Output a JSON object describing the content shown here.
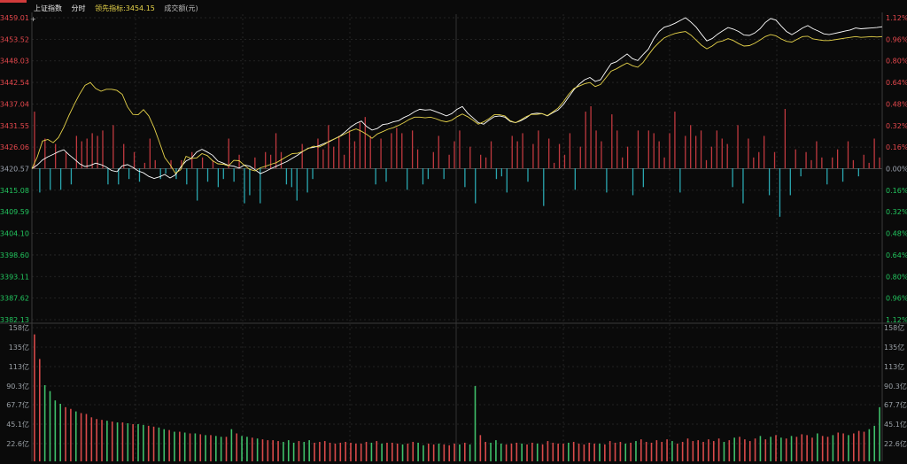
{
  "header": {
    "index_name": "上证指数",
    "period": "分时",
    "leading_label": "领先指标:3454.15",
    "turnover_label": "成交额(元)"
  },
  "colors": {
    "up": "#e5484d",
    "down": "#22c55e",
    "flat": "#9ca3af",
    "price_line": "#ffffff",
    "leading_line": "#e6d34a",
    "bar_up": "#c0393f",
    "bar_down": "#2aa7b0",
    "grid": "#3a3a3a",
    "grid_dotted": "#2b2b2b"
  },
  "chart_data": [
    {
      "type": "line",
      "subtype": "intraday",
      "y_left_ticks": [
        "3459.01",
        "3453.52",
        "3448.03",
        "3442.54",
        "3437.04",
        "3431.55",
        "3426.06",
        "3420.57",
        "3415.08",
        "3409.59",
        "3404.10",
        "3398.60",
        "3393.11",
        "3387.62",
        "3382.13"
      ],
      "y_right_ticks": [
        "1.12%",
        "0.96%",
        "0.80%",
        "0.64%",
        "0.48%",
        "0.32%",
        "0.16%",
        "0.00%",
        "0.16%",
        "0.32%",
        "0.48%",
        "0.64%",
        "0.80%",
        "0.96%",
        "1.12%"
      ],
      "ylim": [
        3382.13,
        3459.01
      ],
      "base_price": 3420.57,
      "series": [
        {
          "name": "上证指数",
          "values": [
            3420.6,
            3421.5,
            3422.8,
            3423.6,
            3424.2,
            3424.9,
            3425.4,
            3424.1,
            3423.0,
            3421.8,
            3421.1,
            3421.4,
            3422.0,
            3421.6,
            3421.0,
            3420.1,
            3419.8,
            3421.3,
            3421.6,
            3420.9,
            3420.0,
            3419.5,
            3418.6,
            3418.1,
            3418.5,
            3419.1,
            3418.2,
            3419.0,
            3421.0,
            3422.5,
            3423.2,
            3424.8,
            3425.5,
            3424.8,
            3424.0,
            3422.5,
            3422.0,
            3421.4,
            3421.2,
            3420.7,
            3421.5,
            3421.2,
            3420.3,
            3419.3,
            3419.9,
            3420.6,
            3421.2,
            3421.8,
            3422.4,
            3423.2,
            3424.0,
            3425.0,
            3425.8,
            3426.0,
            3426.4,
            3427.0,
            3427.5,
            3428.2,
            3428.9,
            3430.0,
            3431.2,
            3432.1,
            3432.7,
            3431.3,
            3430.4,
            3430.8,
            3431.8,
            3432.0,
            3432.5,
            3432.8,
            3433.6,
            3434.2,
            3435.1,
            3435.7,
            3435.5,
            3435.6,
            3435.1,
            3434.6,
            3434.0,
            3434.6,
            3435.7,
            3436.4,
            3434.7,
            3433.5,
            3432.3,
            3431.9,
            3432.9,
            3433.8,
            3434.0,
            3433.7,
            3432.6,
            3432.3,
            3432.8,
            3433.5,
            3434.5,
            3434.7,
            3434.6,
            3434.0,
            3434.8,
            3435.5,
            3436.9,
            3438.8,
            3440.7,
            3442.1,
            3443.2,
            3443.8,
            3442.8,
            3443.2,
            3445.3,
            3447.3,
            3447.8,
            3448.8,
            3449.8,
            3448.6,
            3448.1,
            3449.6,
            3451.0,
            3453.6,
            3455.5,
            3456.6,
            3457.0,
            3457.6,
            3458.3,
            3459.0,
            3457.9,
            3456.6,
            3454.8,
            3453.1,
            3453.7,
            3454.8,
            3455.7,
            3456.5,
            3456.1,
            3455.5,
            3454.6,
            3454.5,
            3455.1,
            3456.2,
            3457.8,
            3458.8,
            3458.4,
            3456.9,
            3455.5,
            3454.7,
            3455.5,
            3456.4,
            3457.0,
            3456.2,
            3455.6,
            3454.9,
            3454.7,
            3455.0,
            3455.3,
            3455.6,
            3455.9,
            3456.4,
            3456.2,
            3456.3,
            3456.4,
            3456.5,
            3456.7
          ]
        },
        {
          "name": "领先指标",
          "values": [
            3420.6,
            3423.5,
            3427.6,
            3428.0,
            3427.2,
            3428.5,
            3431.1,
            3434.2,
            3437.0,
            3439.6,
            3441.8,
            3442.5,
            3441.0,
            3440.3,
            3440.8,
            3440.8,
            3440.5,
            3439.5,
            3436.3,
            3434.4,
            3434.3,
            3435.6,
            3434.0,
            3431.0,
            3427.3,
            3423.4,
            3421.6,
            3419.4,
            3420.3,
            3423.7,
            3423.2,
            3423.3,
            3424.4,
            3423.9,
            3422.6,
            3421.8,
            3421.7,
            3421.3,
            3422.7,
            3422.6,
            3421.4,
            3420.4,
            3420.0,
            3420.8,
            3421.2,
            3421.7,
            3422.1,
            3422.9,
            3423.7,
            3424.4,
            3424.5,
            3425.0,
            3425.7,
            3426.3,
            3426.1,
            3426.7,
            3427.6,
            3428.2,
            3428.8,
            3429.5,
            3430.2,
            3430.7,
            3430.1,
            3429.3,
            3428.3,
            3429.4,
            3430.0,
            3430.6,
            3431.0,
            3431.6,
            3432.3,
            3433.1,
            3433.7,
            3433.7,
            3433.5,
            3433.7,
            3433.3,
            3432.8,
            3432.5,
            3432.9,
            3433.8,
            3434.5,
            3433.8,
            3432.9,
            3431.9,
            3432.5,
            3433.3,
            3434.3,
            3434.3,
            3434.0,
            3432.8,
            3432.3,
            3433.0,
            3433.8,
            3434.4,
            3434.4,
            3434.6,
            3434.1,
            3435.0,
            3436.0,
            3437.6,
            3439.5,
            3441.0,
            3441.6,
            3442.2,
            3442.5,
            3441.5,
            3442.0,
            3443.7,
            3445.4,
            3446.0,
            3446.8,
            3447.5,
            3446.8,
            3446.4,
            3447.6,
            3449.5,
            3451.3,
            3452.7,
            3453.9,
            3454.5,
            3455.0,
            3455.3,
            3455.5,
            3454.6,
            3453.3,
            3452.0,
            3451.1,
            3451.8,
            3452.8,
            3453.1,
            3453.7,
            3453.2,
            3452.4,
            3451.8,
            3451.9,
            3452.5,
            3453.3,
            3454.2,
            3454.7,
            3454.4,
            3453.6,
            3453.0,
            3452.8,
            3453.5,
            3454.2,
            3454.3,
            3453.6,
            3453.4,
            3453.2,
            3453.2,
            3453.4,
            3453.6,
            3453.8,
            3454.0,
            3454.2,
            3454.0,
            3454.1,
            3454.2,
            3454.1,
            3454.2
          ]
        }
      ]
    },
    {
      "type": "bar",
      "subtype": "intraday_flow",
      "note_units": "percent_of_base",
      "values": [
        0.21,
        -0.09,
        0.11,
        -0.08,
        0.09,
        -0.08,
        0.06,
        -0.06,
        0.12,
        0.1,
        0.11,
        0.13,
        0.12,
        0.14,
        -0.06,
        0.16,
        -0.06,
        0.09,
        -0.04,
        0.06,
        -0.05,
        0.02,
        0.11,
        0.03,
        -0.04,
        -0.02,
        0.03,
        -0.04,
        0.03,
        -0.06,
        0.06,
        -0.12,
        0.04,
        -0.05,
        0.03,
        -0.07,
        -0.04,
        0.11,
        -0.05,
        0.05,
        -0.13,
        -0.1,
        0.04,
        -0.13,
        0.06,
        0.05,
        0.13,
        0.06,
        -0.06,
        -0.07,
        -0.12,
        0.09,
        -0.09,
        -0.04,
        0.11,
        0.07,
        0.16,
        0.08,
        0.12,
        0.05,
        0.14,
        0.1,
        0.17,
        0.19,
        0.12,
        -0.06,
        0.11,
        -0.05,
        0.13,
        0.15,
        0.13,
        -0.08,
        0.14,
        0.07,
        -0.06,
        -0.04,
        0.06,
        0.12,
        -0.04,
        0.05,
        0.1,
        0.14,
        -0.07,
        0.08,
        -0.13,
        0.05,
        0.04,
        0.1,
        -0.04,
        -0.03,
        -0.09,
        0.12,
        0.1,
        0.13,
        -0.05,
        0.09,
        0.14,
        -0.14,
        0.11,
        0.02,
        0.09,
        0.05,
        0.13,
        -0.08,
        0.08,
        0.21,
        0.23,
        0.14,
        0.1,
        -0.09,
        0.2,
        0.14,
        0.04,
        0.08,
        -0.1,
        0.14,
        -0.07,
        0.14,
        0.13,
        0.1,
        0.04,
        0.13,
        0.21,
        -0.09,
        0.12,
        0.16,
        0.12,
        0.14,
        0.03,
        0.08,
        0.14,
        0.11,
        0.09,
        -0.07,
        0.16,
        -0.13,
        0.11,
        0.04,
        0.06,
        0.12,
        -0.1,
        0.06,
        -0.18,
        0.22,
        -0.1,
        0.07,
        -0.03,
        0.06,
        0.03,
        0.1,
        0.04,
        -0.06,
        0.04,
        0.07,
        -0.05,
        0.1,
        0.03,
        -0.03,
        0.05,
        0.02,
        0.11,
        0.04
      ]
    },
    {
      "type": "bar",
      "subtype": "volume",
      "ylabel": "成交额(元)",
      "y_ticks": [
        "158亿",
        "135亿",
        "113亿",
        "90.3亿",
        "67.7亿",
        "45.1亿",
        "22.6亿"
      ],
      "ylim": [
        0,
        158
      ],
      "values": [
        150,
        121,
        90,
        83,
        72,
        68,
        64,
        62,
        59,
        57,
        56,
        52,
        50,
        49,
        48,
        47,
        46,
        46,
        45,
        44,
        44,
        43,
        42,
        41,
        40,
        38,
        37,
        35,
        35,
        34,
        33,
        33,
        32,
        31,
        31,
        30,
        29,
        29,
        38,
        33,
        30,
        29,
        28,
        27,
        26,
        25,
        25,
        24,
        23,
        25,
        22,
        24,
        23,
        25,
        22,
        23,
        24,
        22,
        21,
        22,
        23,
        22,
        21,
        21,
        23,
        22,
        24,
        21,
        22,
        22,
        21,
        20,
        21,
        23,
        22,
        19,
        21,
        20,
        21,
        20,
        19,
        21,
        20,
        22,
        20,
        89,
        31,
        23,
        22,
        25,
        21,
        20,
        21,
        22,
        21,
        20,
        22,
        21,
        20,
        24,
        22,
        21,
        21,
        22,
        23,
        21,
        20,
        22,
        21,
        21,
        20,
        24,
        22,
        23,
        21,
        22,
        24,
        26,
        23,
        22,
        25,
        23,
        26,
        24,
        21,
        23,
        27,
        24,
        25,
        23,
        26,
        24,
        27,
        23,
        25,
        28,
        29,
        26,
        24,
        27,
        30,
        26,
        29,
        31,
        28,
        27,
        30,
        29,
        32,
        31,
        28,
        33,
        30,
        29,
        31,
        34,
        33,
        31,
        33,
        36,
        35,
        38,
        42,
        64
      ],
      "up_flags": [
        1,
        1,
        0,
        0,
        0,
        0,
        1,
        1,
        0,
        1,
        1,
        1,
        1,
        1,
        0,
        1,
        0,
        1,
        0,
        1,
        0,
        0,
        1,
        1,
        0,
        0,
        1,
        0,
        1,
        0,
        1,
        0,
        1,
        0,
        1,
        0,
        0,
        1,
        0,
        1,
        0,
        0,
        1,
        0,
        1,
        1,
        1,
        1,
        0,
        0,
        0,
        1,
        0,
        0,
        1,
        1,
        1,
        1,
        1,
        1,
        1,
        1,
        1,
        1,
        1,
        0,
        1,
        0,
        1,
        1,
        1,
        0,
        1,
        1,
        0,
        0,
        1,
        1,
        0,
        1,
        1,
        1,
        0,
        1,
        0,
        0,
        1,
        1,
        0,
        0,
        0,
        1,
        1,
        1,
        0,
        1,
        1,
        0,
        1,
        1,
        1,
        1,
        1,
        0,
        1,
        1,
        1,
        1,
        1,
        0,
        1,
        1,
        1,
        1,
        0,
        1,
        0,
        1,
        1,
        1,
        1,
        1,
        1,
        0,
        1,
        1,
        1,
        1,
        1,
        1,
        1,
        1,
        1,
        0,
        1,
        0,
        1,
        1,
        1,
        1,
        0,
        1,
        0,
        1,
        0,
        1,
        0,
        1,
        1,
        1,
        1,
        0,
        1,
        1,
        0,
        1,
        1,
        0,
        1,
        1,
        1,
        0
      ]
    }
  ]
}
